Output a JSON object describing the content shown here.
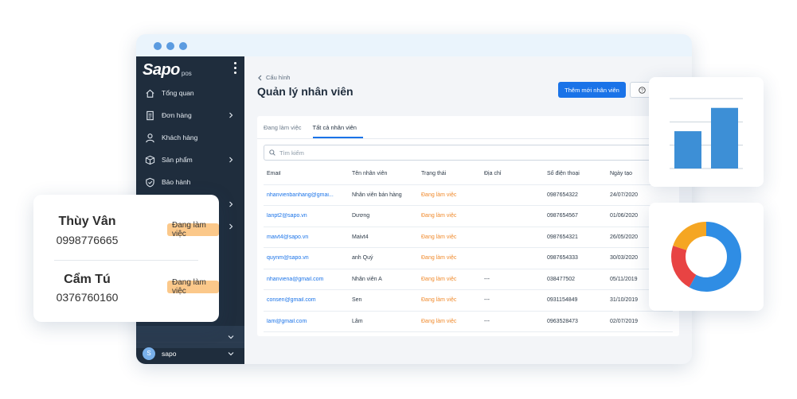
{
  "sidebar": {
    "logo": "Sapo",
    "logo_sub": "pos",
    "items": [
      {
        "label": "Tổng quan",
        "icon": "home-icon"
      },
      {
        "label": "Đơn hàng",
        "icon": "order-icon"
      },
      {
        "label": "Khách hàng",
        "icon": "user-icon"
      },
      {
        "label": "Sản phẩm",
        "icon": "box-icon"
      },
      {
        "label": "Bảo hành",
        "icon": "shield-icon"
      }
    ],
    "user": {
      "initial": "S",
      "name": "sapo"
    }
  },
  "header": {
    "breadcrumb": "Cấu hình",
    "title": "Quản lý nhân viên",
    "add_button": "Thêm mới nhân viên"
  },
  "tabs": [
    {
      "label": "Đang làm việc",
      "active": false
    },
    {
      "label": "Tất cả nhân viên",
      "active": true
    }
  ],
  "search": {
    "placeholder": "Tìm kiếm"
  },
  "table": {
    "headers": [
      "Email",
      "Tên nhân viên",
      "Trạng thái",
      "Địa chỉ",
      "Số điện thoại",
      "Ngày tạo"
    ],
    "rows": [
      [
        "nhanvienbanhang@gmai...",
        "Nhân viên bán hàng",
        "Đang làm việc",
        "",
        "0987654322",
        "24/07/2020"
      ],
      [
        "lanpt2@sapo.vn",
        "Dương",
        "Đang làm việc",
        "",
        "0987654567",
        "01/06/2020"
      ],
      [
        "maivt4@sapo.vn",
        "Maivt4",
        "Đang làm việc",
        "",
        "0987654321",
        "26/05/2020"
      ],
      [
        "quynm@sapo.vn",
        "anh Quý",
        "Đang làm việc",
        "",
        "0987654333",
        "30/03/2020"
      ],
      [
        "nhanviena@gmail.com",
        "Nhân viên A",
        "Đang làm việc",
        "---",
        "038477502",
        "05/11/2019"
      ],
      [
        "consen@gmail.com",
        "Sen",
        "Đang làm việc",
        "---",
        "0931154849",
        "31/10/2019"
      ],
      [
        "lam@gmail.com",
        "Lâm",
        "Đang làm việc",
        "---",
        "0963528473",
        "02/07/2019"
      ]
    ]
  },
  "employee_card": [
    {
      "name": "Thùy Vân",
      "phone": "0998776665",
      "status": "Đang làm việc"
    },
    {
      "name": "Cẩm Tú",
      "phone": "0376760160",
      "status": "Đang làm việc"
    }
  ],
  "colors": {
    "sidebar": "#1f2d3d",
    "primary": "#1a73e8",
    "status": "#f08a2c",
    "badge": "#fbc88a",
    "bar": "#3d8fd6"
  },
  "chart_data": [
    {
      "type": "bar",
      "categories": [
        "",
        ""
      ],
      "values": [
        1.6,
        2.6
      ],
      "ylim": [
        0,
        3
      ],
      "grid": true
    },
    {
      "type": "pie",
      "categories": [
        "",
        "",
        ""
      ],
      "values": [
        58,
        22,
        20
      ],
      "colors": [
        "#2f8de4",
        "#e84343",
        "#f5a623"
      ],
      "donut": true
    }
  ]
}
